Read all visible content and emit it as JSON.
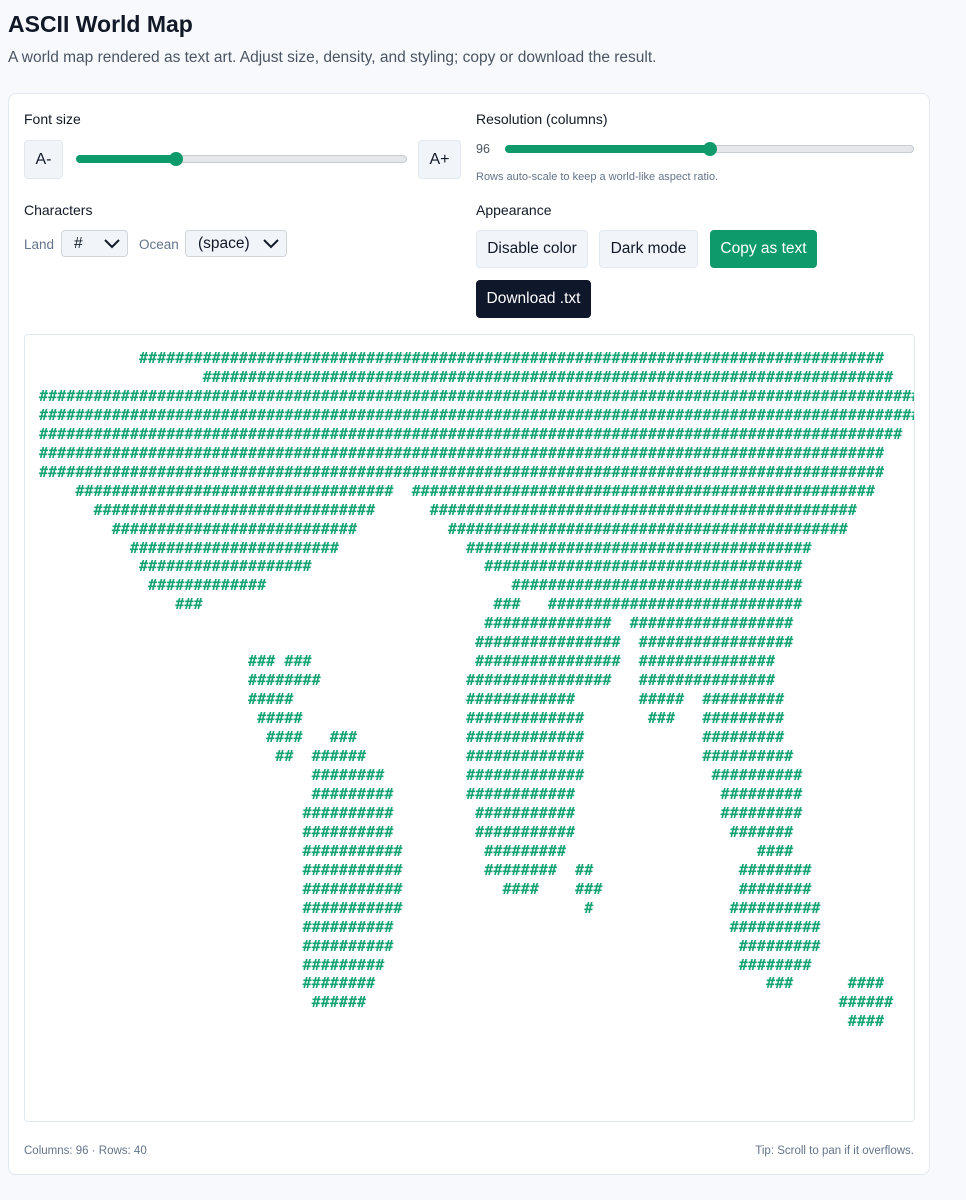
{
  "header": {
    "title": "ASCII World Map",
    "subtitle": "A world map rendered as text art. Adjust size, density, and styling; copy or download the result."
  },
  "controls": {
    "font_size": {
      "label": "Font size",
      "decrease_label": "A-",
      "increase_label": "A+",
      "level": 0.3
    },
    "resolution": {
      "label": "Resolution (columns)",
      "value": "96",
      "level": 0.5,
      "hint": "Rows auto-scale to keep a world-like aspect ratio."
    },
    "characters": {
      "label": "Characters",
      "land_label": "Land",
      "land_value": "#",
      "ocean_label": "Ocean",
      "ocean_value": "(space)"
    },
    "appearance": {
      "label": "Appearance",
      "disable_color_label": "Disable color",
      "dark_mode_label": "Dark mode",
      "copy_label": "Copy as text",
      "download_label": "Download .txt"
    }
  },
  "colors": {
    "accent": "#0e9a6a",
    "map_text": "#14a372",
    "dark_button": "#0f172a"
  },
  "map": {
    "text": "           ##################################################################################\n                  ############################################################################\n##################################################################################################\n##################################################################################################\n###############################################################################################\n#############################################################################################\n#############################################################################################\n    ###################################  ###################################################\n      ###############################      ###############################################\n        ###########################          ############################################\n          #######################              ######################################\n           ###################                   ###################################\n            #############                           ################################\n               ###                                ###   ############################\n                                                 ##############  ##################\n                                                ################  #################\n                       ### ###                  ################  ###############\n                       ########                ################   ###############\n                       #####                   ############       #####  #########\n                        #####                  #############       ###   #########\n                         ####   ###            #############             #########\n                          ##  ######           #############             ##########\n                              ########         #############              ##########\n                              #########        ############                #########\n                             ##########         ###########                #########\n                             ##########         ###########                 #######\n                             ###########         #########                     ####\n                             ###########         ########  ##                ########\n                             ###########           ####    ###               ########\n                             ###########                    #               ##########\n                             ##########                                     ##########\n                             ##########                                      #########\n                             #########                                       ########\n                             ########                                           ###      ####\n                              ######                                                    ######\n                                                                                         ####"
  },
  "footer": {
    "stats": "Columns: 96 · Rows: 40",
    "tip": "Tip: Scroll to pan if it overflows."
  }
}
